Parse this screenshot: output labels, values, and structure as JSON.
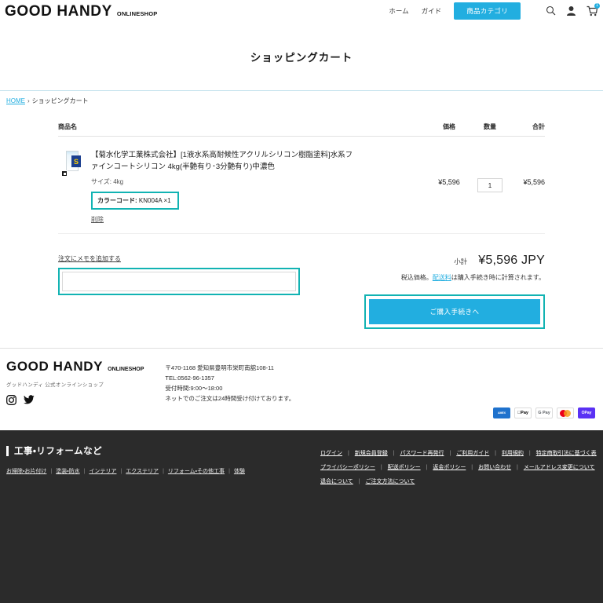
{
  "header": {
    "logo_main": "GOOD HANDY",
    "logo_sub": "ONLINESHOP",
    "nav": [
      {
        "label": "ホーム",
        "name": "nav-home"
      },
      {
        "label": "ガイド",
        "name": "nav-guide"
      }
    ],
    "cta_label": "商品カテゴリ",
    "cart_badge": "1",
    "icons": [
      "search-icon",
      "account-icon",
      "cart-icon"
    ]
  },
  "page": {
    "title": "ショッピングカート"
  },
  "breadcrumb": {
    "home": "HOME",
    "separator": "›",
    "current": "ショッピングカート"
  },
  "cart": {
    "columns": {
      "name": "商品名",
      "price": "価格",
      "qty": "数量",
      "total": "合計"
    },
    "items": [
      {
        "title": "【菊水化学工業株式会社】[1液水系高耐候性アクリルシリコン樹脂塗料]水系ファインコートシリコン 4kg(半艶有り･3分艶有り)中濃色",
        "variant_label": "サイズ:",
        "variant_value": "4kg",
        "colorcode_label": "カラーコード:",
        "colorcode_value": "KN004A ×1",
        "remove_label": "削除",
        "price": "¥5,596",
        "qty": "1",
        "total": "¥5,596"
      }
    ]
  },
  "note": {
    "label": "注文にメモを追加する",
    "value": "",
    "placeholder": ""
  },
  "summary": {
    "subtotal_label": "小計",
    "subtotal_value": "¥5,596 JPY",
    "tax_prefix": "税込価格。",
    "shipping_link": "配送料",
    "tax_suffix": "は購入手続き時に計算されます。",
    "checkout_label": "ご購入手続きへ"
  },
  "footer": {
    "logo_main": "GOOD HANDY",
    "logo_sub": "ONLINESHOP",
    "tagline": "グッドハンディ 公式オンラインショップ",
    "social": [
      "instagram-icon",
      "twitter-icon"
    ],
    "address": [
      "〒470-1168 愛知県豊明市栄町南舘108-11",
      "TEL:0562-96-1357",
      "受付時間:9:00〜18:00",
      "ネットでのご注文は24時間受け付けております。"
    ],
    "payments": [
      {
        "name": "amex",
        "label": "AMERICAN EXPRESS"
      },
      {
        "name": "apple-pay",
        "label": "Pay"
      },
      {
        "name": "google-pay",
        "label": "Pay"
      },
      {
        "name": "mastercard",
        "label": ""
      },
      {
        "name": "paypay",
        "label": "OPay"
      }
    ]
  },
  "footer_dark": {
    "heading": "工事・リフォームなど",
    "categories": [
      "お掃除・お片付け",
      "塗装・防水",
      "インテリア",
      "エクステリア",
      "リフォーム・その他工事",
      "体験"
    ],
    "links_rows": [
      [
        "ログイン",
        "新規会員登録",
        "パスワード再発行",
        "ご利用ガイド",
        "利用規約",
        "特定商取引法に基づく表"
      ],
      [
        "プライバシーポリシー",
        "配送ポリシー",
        "返金ポリシー",
        "お問い合わせ",
        "メールアドレス変更について"
      ],
      [
        "退会について",
        "ご注文方法について"
      ]
    ]
  },
  "colors": {
    "accent": "#22aee0",
    "highlight": "#12b3b3",
    "footer_dark_bg": "#2b2b2b"
  }
}
